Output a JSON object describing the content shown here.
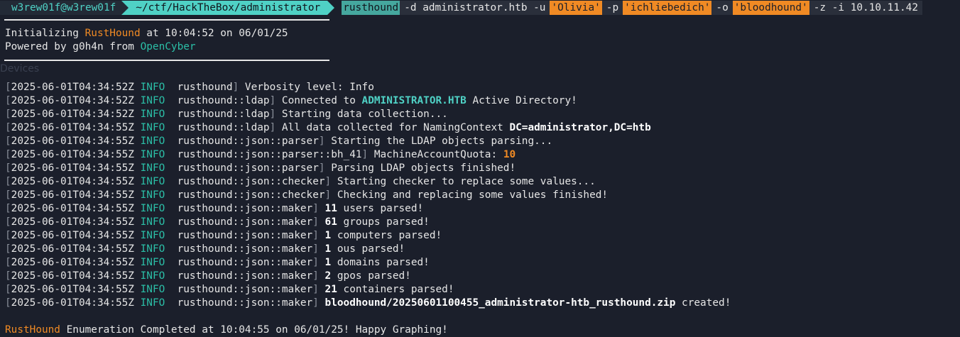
{
  "prompt": {
    "user_host": "w3rew01f@w3rew01f",
    "path": "~/ctf/HackTheBox/administrator",
    "command": "rusthound",
    "args": [
      {
        "text": "-d administrator.htb -u",
        "kind": "arg"
      },
      {
        "text": "'Olivia'",
        "kind": "str"
      },
      {
        "text": "-p",
        "kind": "arg"
      },
      {
        "text": "'ichliebedich'",
        "kind": "str"
      },
      {
        "text": "-o",
        "kind": "arg"
      },
      {
        "text": "'bloodhound'",
        "kind": "str"
      },
      {
        "text": "-z -i 10.10.11.42",
        "kind": "arg"
      }
    ]
  },
  "banner": {
    "init_prefix": "Initializing ",
    "tool_name": "RustHound",
    "init_suffix": " at 10:04:52 on 06/01/25",
    "powered_prefix": "Powered by g0h4n from ",
    "org_name": "OpenCyber"
  },
  "background_label": "Devices",
  "log_lines": [
    {
      "ts": "2025-06-01T04:34:52Z",
      "level": "INFO",
      "module": "rusthound",
      "parts": [
        {
          "t": "Verbosity level: Info",
          "s": "n"
        }
      ]
    },
    {
      "ts": "2025-06-01T04:34:52Z",
      "level": "INFO",
      "module": "rusthound::ldap",
      "parts": [
        {
          "t": "Connected to ",
          "s": "n"
        },
        {
          "t": "ADMINISTRATOR.HTB",
          "s": "teal"
        },
        {
          "t": " Active Directory!",
          "s": "n"
        }
      ]
    },
    {
      "ts": "2025-06-01T04:34:52Z",
      "level": "INFO",
      "module": "rusthound::ldap",
      "parts": [
        {
          "t": "Starting data collection...",
          "s": "n"
        }
      ]
    },
    {
      "ts": "2025-06-01T04:34:55Z",
      "level": "INFO",
      "module": "rusthound::ldap",
      "parts": [
        {
          "t": "All data collected for NamingContext ",
          "s": "n"
        },
        {
          "t": "DC=administrator,DC=htb",
          "s": "bold"
        }
      ]
    },
    {
      "ts": "2025-06-01T04:34:55Z",
      "level": "INFO",
      "module": "rusthound::json::parser",
      "parts": [
        {
          "t": "Starting the LDAP objects parsing...",
          "s": "n"
        }
      ]
    },
    {
      "ts": "2025-06-01T04:34:55Z",
      "level": "INFO",
      "module": "rusthound::json::parser::bh_41",
      "parts": [
        {
          "t": "MachineAccountQuota: ",
          "s": "n"
        },
        {
          "t": "10",
          "s": "orange"
        }
      ]
    },
    {
      "ts": "2025-06-01T04:34:55Z",
      "level": "INFO",
      "module": "rusthound::json::parser",
      "parts": [
        {
          "t": "Parsing LDAP objects finished!",
          "s": "n"
        }
      ]
    },
    {
      "ts": "2025-06-01T04:34:55Z",
      "level": "INFO",
      "module": "rusthound::json::checker",
      "parts": [
        {
          "t": "Starting checker to replace some values...",
          "s": "n"
        }
      ]
    },
    {
      "ts": "2025-06-01T04:34:55Z",
      "level": "INFO",
      "module": "rusthound::json::checker",
      "parts": [
        {
          "t": "Checking and replacing some values finished!",
          "s": "n"
        }
      ]
    },
    {
      "ts": "2025-06-01T04:34:55Z",
      "level": "INFO",
      "module": "rusthound::json::maker",
      "parts": [
        {
          "t": "11",
          "s": "bold"
        },
        {
          "t": " users parsed!",
          "s": "n"
        }
      ]
    },
    {
      "ts": "2025-06-01T04:34:55Z",
      "level": "INFO",
      "module": "rusthound::json::maker",
      "parts": [
        {
          "t": "61",
          "s": "bold"
        },
        {
          "t": " groups parsed!",
          "s": "n"
        }
      ]
    },
    {
      "ts": "2025-06-01T04:34:55Z",
      "level": "INFO",
      "module": "rusthound::json::maker",
      "parts": [
        {
          "t": "1",
          "s": "bold"
        },
        {
          "t": " computers parsed!",
          "s": "n"
        }
      ]
    },
    {
      "ts": "2025-06-01T04:34:55Z",
      "level": "INFO",
      "module": "rusthound::json::maker",
      "parts": [
        {
          "t": "1",
          "s": "bold"
        },
        {
          "t": " ous parsed!",
          "s": "n"
        }
      ]
    },
    {
      "ts": "2025-06-01T04:34:55Z",
      "level": "INFO",
      "module": "rusthound::json::maker",
      "parts": [
        {
          "t": "1",
          "s": "bold"
        },
        {
          "t": " domains parsed!",
          "s": "n"
        }
      ]
    },
    {
      "ts": "2025-06-01T04:34:55Z",
      "level": "INFO",
      "module": "rusthound::json::maker",
      "parts": [
        {
          "t": "2",
          "s": "bold"
        },
        {
          "t": " gpos parsed!",
          "s": "n"
        }
      ]
    },
    {
      "ts": "2025-06-01T04:34:55Z",
      "level": "INFO",
      "module": "rusthound::json::maker",
      "parts": [
        {
          "t": "21",
          "s": "bold"
        },
        {
          "t": " containers parsed!",
          "s": "n"
        }
      ]
    },
    {
      "ts": "2025-06-01T04:34:55Z",
      "level": "INFO",
      "module": "rusthound::json::maker",
      "parts": [
        {
          "t": "bloodhound/20250601100455_administrator-htb_rusthound.zip",
          "s": "bold"
        },
        {
          "t": " created!",
          "s": "n"
        }
      ]
    }
  ],
  "footer": {
    "tool_name": "RustHound",
    "message": " Enumeration Completed at 10:04:55 on 06/01/25! Happy Graphing!"
  },
  "colors": {
    "background": "#1b1f2b",
    "accent_teal": "#4fd1c5",
    "accent_orange": "#f08a24",
    "info_green": "#2bbfa7"
  }
}
